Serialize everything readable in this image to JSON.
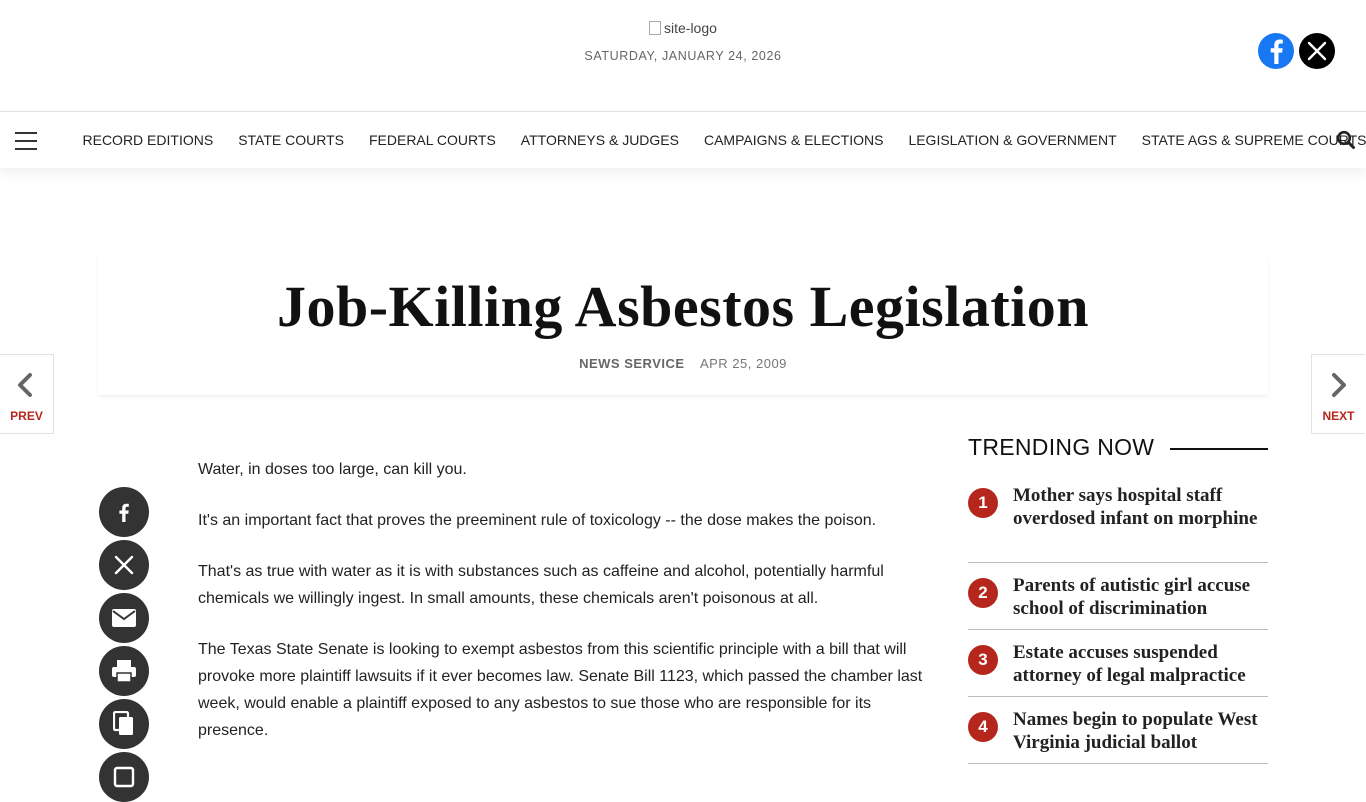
{
  "header": {
    "logo_alt": "site-logo",
    "date": "SATURDAY, JANUARY 24, 2026",
    "social": [
      {
        "icon": "facebook-icon",
        "color": "#1877f2"
      },
      {
        "icon": "x-icon",
        "color": "#000000"
      }
    ]
  },
  "nav": {
    "items": [
      "RECORD EDITIONS",
      "STATE COURTS",
      "FEDERAL COURTS",
      "ATTORNEYS & JUDGES",
      "CAMPAIGNS & ELECTIONS",
      "LEGISLATION & GOVERNMENT",
      "STATE AGS & SUPREME COURTS"
    ]
  },
  "article": {
    "title": "Job-Killing Asbestos Legislation",
    "source": "NEWS SERVICE",
    "date": "APR 25, 2009",
    "paragraphs": [
      "Water, in doses too large, can kill you.",
      "It's an important fact that proves the preeminent rule of toxicology -- the dose makes the poison.",
      "That's as true with water as it is with substances such as caffeine and alcohol, potentially harmful chemicals we willingly ingest. In small amounts, these chemicals aren't poisonous at all.",
      "The Texas State Senate is looking to exempt asbestos from this scientific principle with a bill that will provoke more plaintiff lawsuits if it ever becomes law. Senate Bill 1123, which passed the chamber last week, would enable a plaintiff exposed to any asbestos to sue those who are responsible for its presence."
    ]
  },
  "pager": {
    "prev": "PREV",
    "next": "NEXT"
  },
  "share": [
    "facebook-icon",
    "x-icon",
    "envelope-icon",
    "printer-icon",
    "copy-icon",
    "more-icon"
  ],
  "trending": {
    "heading": "TRENDING NOW",
    "items": [
      {
        "num": "1",
        "title": "Mother says hospital staff overdosed infant on morphine"
      },
      {
        "num": "2",
        "title": "Parents of autistic girl accuse school of discrimination"
      },
      {
        "num": "3",
        "title": "Estate accuses suspended attorney of legal malpractice"
      },
      {
        "num": "4",
        "title": "Names begin to populate West Virginia judicial ballot"
      }
    ]
  },
  "colors": {
    "accent": "#b5261c",
    "share_bg": "#333333"
  }
}
